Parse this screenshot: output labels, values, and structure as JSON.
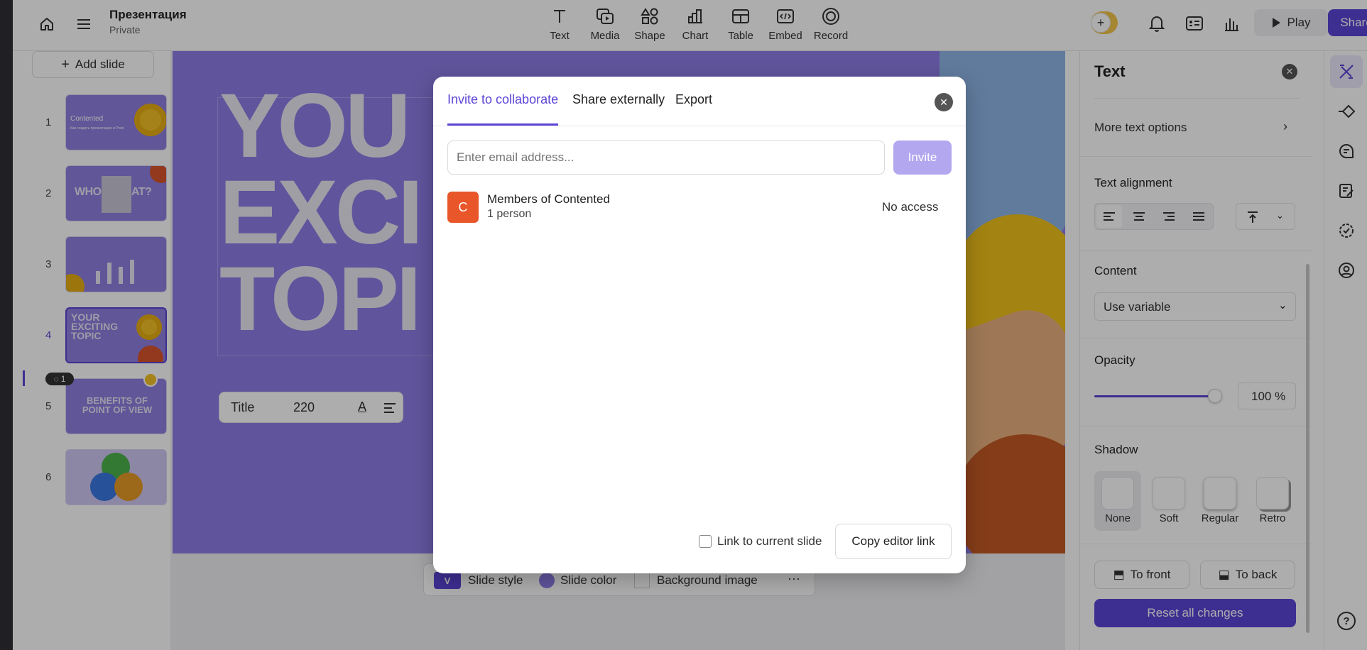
{
  "doc": {
    "title": "Презентация",
    "visibility": "Private"
  },
  "toolbar": {
    "tools": [
      {
        "label": "Text",
        "icon": "text-icon"
      },
      {
        "label": "Media",
        "icon": "media-icon"
      },
      {
        "label": "Shape",
        "icon": "shape-icon"
      },
      {
        "label": "Chart",
        "icon": "chart-icon"
      },
      {
        "label": "Table",
        "icon": "table-icon"
      },
      {
        "label": "Embed",
        "icon": "embed-icon"
      },
      {
        "label": "Record",
        "icon": "record-icon"
      }
    ],
    "play_label": "Play",
    "share_label": "Share"
  },
  "left": {
    "add_slide_label": "Add slide",
    "slides": [
      {
        "number": "1",
        "title": "Contented",
        "subtitle": "Как создать презентацию в Prezi"
      },
      {
        "number": "2",
        "title": "WHO IS THAT?"
      },
      {
        "number": "3",
        "title": ""
      },
      {
        "number": "4",
        "title": "YOUR EXCITING TOPIC"
      },
      {
        "number": "5",
        "title": "BENEFITS OF POINT OF VIEW",
        "comments": "1"
      },
      {
        "number": "6",
        "title": ""
      }
    ]
  },
  "slide": {
    "big_text": [
      "YOU",
      "EXCI",
      "TOPI"
    ],
    "text_toolbar": {
      "style": "Title",
      "size": "220"
    }
  },
  "bottom_bar": {
    "slide_style": "Slide style",
    "slide_style_letter": "V",
    "slide_color": "Slide color",
    "background_image": "Background image"
  },
  "modal": {
    "tabs": [
      "Invite to collaborate",
      "Share externally",
      "Export"
    ],
    "email_placeholder": "Enter email address...",
    "invite_label": "Invite",
    "member": {
      "initial": "C",
      "name": "Members of Contented",
      "count": "1 person",
      "access": "No access"
    },
    "link_checkbox_label": "Link to current slide",
    "copy_link_label": "Copy editor link"
  },
  "panel": {
    "title": "Text",
    "more_options": "More text options",
    "alignment_heading": "Text alignment",
    "content_heading": "Content",
    "content_value": "Use variable",
    "opacity_heading": "Opacity",
    "opacity_value": "100 %",
    "opacity_level": 1.0,
    "shadow_heading": "Shadow",
    "shadow_options": [
      "None",
      "Soft",
      "Regular",
      "Retro"
    ],
    "to_front": "To front",
    "to_back": "To back",
    "reset": "Reset all changes"
  },
  "colors": {
    "accent": "#5b45d6",
    "slide_bg": "#8e7de6",
    "member_avatar": "#e8562a"
  }
}
